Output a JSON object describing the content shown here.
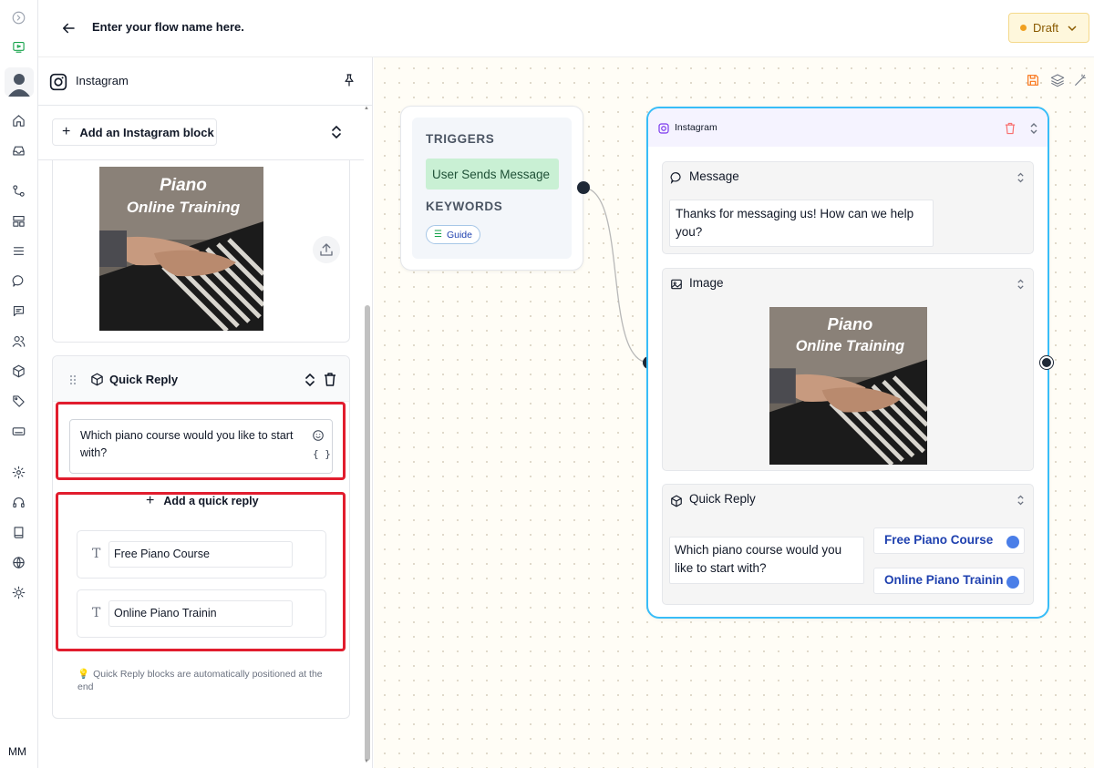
{
  "header": {
    "flow_name": "Enter your flow name here.",
    "status": "Draft"
  },
  "user": {
    "initials": "MM"
  },
  "rail": {
    "icons": [
      "collapse-icon",
      "chatbot-icon",
      "user-avatar",
      "home-icon",
      "inbox-icon",
      "flow-icon",
      "templates-icon",
      "list-icon",
      "chat-icon",
      "messages-icon",
      "contacts-icon",
      "box-icon",
      "tag-icon",
      "keyboard-icon",
      "settings-icon",
      "headset-icon",
      "book-icon",
      "globe-icon",
      "theme-icon"
    ]
  },
  "panel": {
    "title": "Instagram",
    "add_block_label": "Add an Instagram block",
    "quick_reply": {
      "title": "Quick Reply",
      "message": "Which piano course would you like to start with?",
      "variable_token": "{ }",
      "add_label": "Add a quick reply",
      "replies": [
        "Free Piano Course",
        "Online Piano Trainin"
      ],
      "tip": "Quick Reply blocks are automatically positioned at the end"
    },
    "image_caption_line1": "Piano",
    "image_caption_line2": "Online Training"
  },
  "canvas": {
    "trigger_node": {
      "triggers_label": "TRIGGERS",
      "trigger": "User Sends Message",
      "keywords_label": "KEYWORDS",
      "keyword": "Guide"
    },
    "instagram_node": {
      "title": "Instagram",
      "message_title": "Message",
      "message_text": "Thanks for messaging us! How can we help you?",
      "image_title": "Image",
      "quick_reply_title": "Quick Reply",
      "quick_reply_text": "Which piano course would you like to start with?",
      "buttons": [
        "Free Piano Course",
        "Online Piano Trainin"
      ]
    }
  },
  "colors": {
    "accent_blue": "#38bdf8",
    "highlight_red": "#e11d2e",
    "trigger_green": "#c9f0d4",
    "draft_bg": "#fef7dc"
  }
}
